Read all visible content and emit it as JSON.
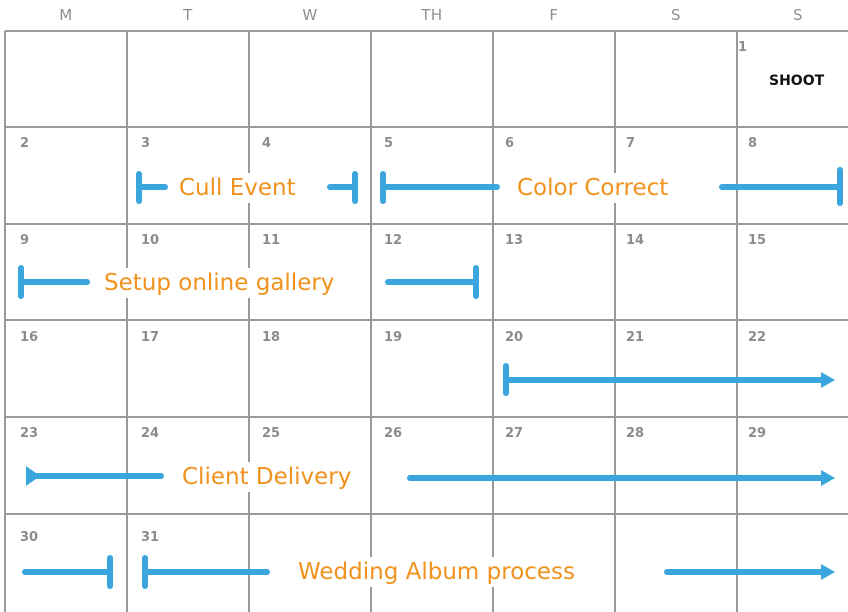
{
  "colors": {
    "grid": "#9a9a9a",
    "bar": "#3aa6dd",
    "label": "#f0921e",
    "day_number": "#8c8c8c",
    "header": "#8f8f8f"
  },
  "weekday_headers": [
    "M",
    "T",
    "W",
    "TH",
    "F",
    "S",
    "S"
  ],
  "day_numbers": [
    "1",
    "2",
    "3",
    "4",
    "5",
    "6",
    "7",
    "8",
    "9",
    "10",
    "11",
    "12",
    "13",
    "14",
    "15",
    "16",
    "17",
    "18",
    "19",
    "20",
    "21",
    "22",
    "23",
    "24",
    "25",
    "26",
    "27",
    "28",
    "29",
    "30",
    "31"
  ],
  "events": {
    "shoot": "SHOOT",
    "cull": "Cull Event",
    "color": "Color Correct",
    "gallery": "Setup online gallery",
    "delivery": "Client Delivery",
    "album": "Wedding Album process"
  }
}
